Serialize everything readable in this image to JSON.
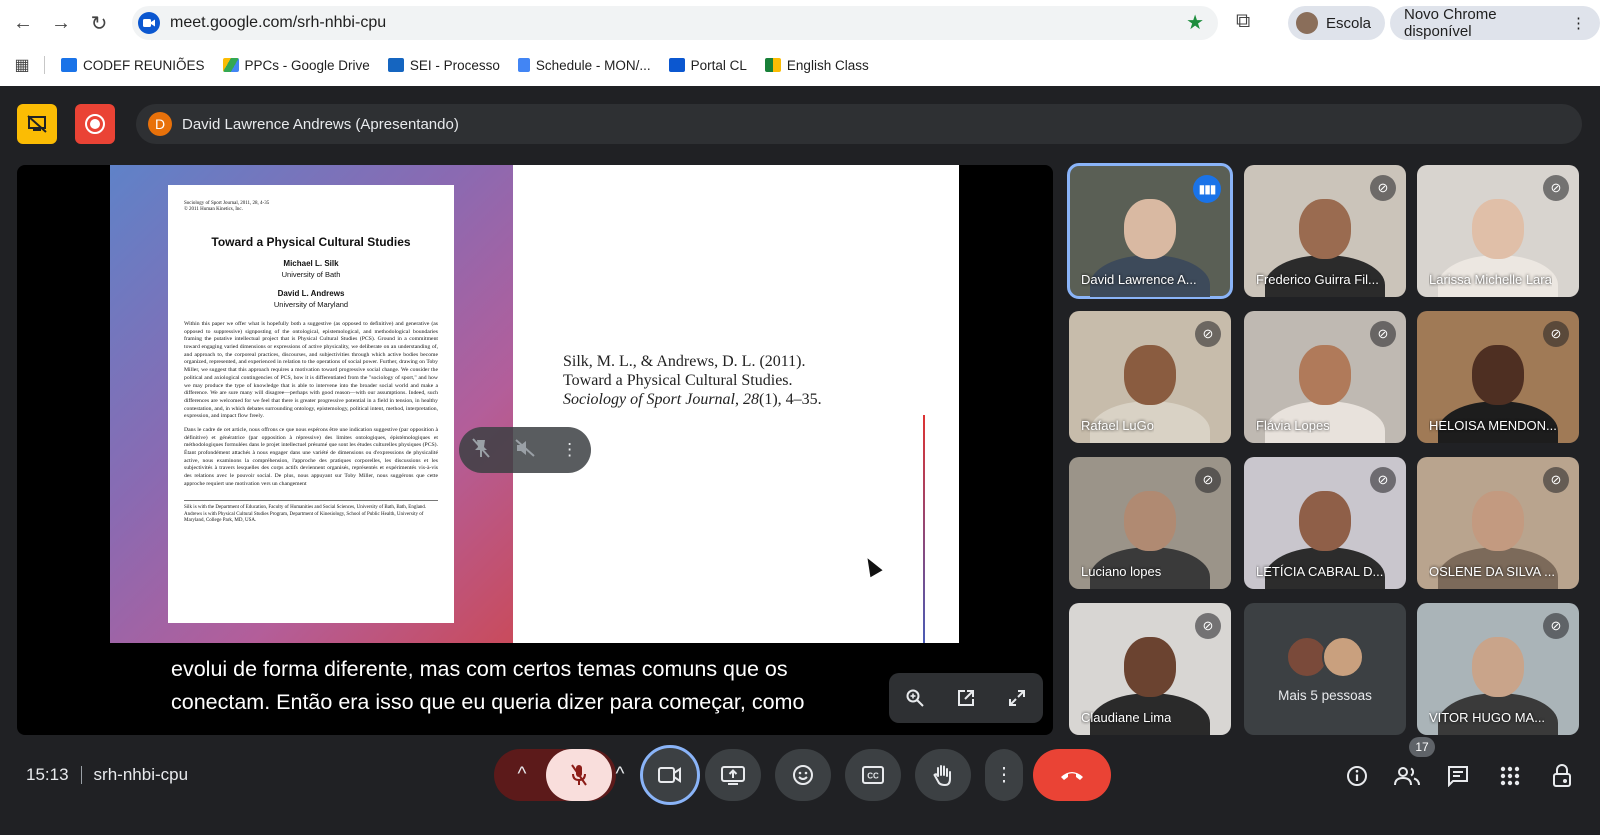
{
  "browser": {
    "url": "meet.google.com/srh-nhbi-cpu",
    "profile_label": "Escola",
    "new_chrome_label": "Novo Chrome disponível",
    "bookmarks": [
      {
        "label": "CODEF REUNIÕES",
        "color": "#1a73e8"
      },
      {
        "label": "PPCs - Google Drive",
        "color": "#34a853"
      },
      {
        "label": "SEI - Processo",
        "color": "#1565c0"
      },
      {
        "label": "Schedule - MON/...",
        "color": "#4285f4"
      },
      {
        "label": "Portal CL",
        "color": "#0b57d0"
      },
      {
        "label": "English Class",
        "color": "#188038"
      }
    ]
  },
  "meet": {
    "presenter_initial": "D",
    "presenter_label": "David Lawrence Andrews (Apresentando)",
    "slide": {
      "paper_meta": "Sociology of Sport Journal, 2011, 28, 4-35\n© 2011 Human Kinetics, Inc.",
      "paper_title": "Toward a Physical Cultural Studies",
      "author1": "Michael L. Silk",
      "affil1": "University of Bath",
      "author2": "David L. Andrews",
      "affil2": "University of Maryland",
      "abstract_en": "Within this paper we offer what is hopefully both a suggestive (as opposed to definitive) and generative (as opposed to suppressive) signposting of the ontological, epistemological, and methodological boundaries framing the putative intellectual project that is Physical Cultural Studies (PCS). Ground in a commitment toward engaging varied dimensions or expressions of active physicality, we deliberate on an understanding of, and approach to, the corporeal practices, discourses, and subjectivities through which active bodies become organized, represented, and experienced in relation to the operations of social power. Further, drawing on Toby Miller, we suggest that this approach requires a motivation toward progressive social change. We consider the political and axiological contingencies of PCS, how it is differentiated from the \"sociology of sport,\" and how we may produce the type of knowledge that is able to intervene into the broader social world and make a difference. We are sure many will disagree—perhaps with good reason—with our assumptions. Indeed, such differences are welcomed for we feel that there is greater progressive potential in a field in tension, in healthy contestation, and, in which debates surrounding ontology, epistemology, political intent, method, interpretation, expression, and impact flow freely.",
      "abstract_fr": "Dans le cadre de cet article, nous offrons ce que nous espérons être une indication suggestive (par opposition à définitive) et génératrice (par opposition à répressive) des limites ontologiques, épistémologiques et méthodologiques formulées dans le projet intellectuel présumé que sont les études culturelles physiques (PCS). Étant profondément attachés à nous engager dans une variété de dimensions ou d'expressions de physicalité active, nous examinons la compréhension, l'approche des pratiques corporelles, les discussions et les subjectivités à travers lesquelles des corps actifs deviennent organisés, représentés et expérimentés vis-à-vis des relations avec le pouvoir social. De plus, nous appuyant sur Toby Miller, nous suggérons que cette approche requiert une motivation vers un changement",
      "footnote": "Silk is with the Department of Education, Faculty of Humanities and Social Sciences, University of Bath, Bath, England. Andrews is with Physical Cultural Studies Program, Department of Kinesiology, School of Public Health, University of Maryland, College Park, MD, USA.",
      "citation_line1": "Silk, M. L., & Andrews, D. L. (2011).",
      "citation_line2": "Toward a Physical Cultural Studies.",
      "citation_journal": "Sociology of Sport Journal",
      "citation_sep": ", ",
      "citation_volume": "28",
      "citation_rest": "(1), 4–35."
    },
    "caption_line1": "evolui de forma diferente, mas com certos temas comuns que os",
    "caption_line2": "conectam. Então era isso que eu queria dizer para começar, como",
    "participants": [
      {
        "name": "David Lawrence A...",
        "speaking": true,
        "bg": "#5a5f55",
        "skin": "#d9b9a2",
        "shirt": "#3d4a5a"
      },
      {
        "name": "Frederico Guirra Fil...",
        "speaking": false,
        "bg": "#cbc4ba",
        "skin": "#9a6b50",
        "shirt": "#2b2b2b"
      },
      {
        "name": "Larissa Michelle Lara",
        "speaking": false,
        "bg": "#d8d4cf",
        "skin": "#e0bfa8",
        "shirt": "#ece7e1"
      },
      {
        "name": "Rafael LuGo",
        "speaking": false,
        "bg": "#c7bcab",
        "skin": "#8a5c40",
        "shirt": "#d9d2c5"
      },
      {
        "name": "Flávia Lopes",
        "speaking": false,
        "bg": "#bfb9b2",
        "skin": "#b07a5a",
        "shirt": "#e8e2dc"
      },
      {
        "name": "HELOISA MENDON...",
        "speaking": false,
        "bg": "#a07a56",
        "skin": "#4e2f22",
        "shirt": "#1d1d1d"
      },
      {
        "name": "Luciano lopes",
        "speaking": false,
        "bg": "#9b9489",
        "skin": "#b08a72",
        "shirt": "#3a3a3a"
      },
      {
        "name": "LETÍCIA CABRAL D...",
        "speaking": false,
        "bg": "#c9c6cd",
        "skin": "#8f5f48",
        "shirt": "#2c2c2c"
      },
      {
        "name": "OSLENE DA SILVA ...",
        "speaking": false,
        "bg": "#b9a48e",
        "skin": "#c39a80",
        "shirt": "#7c6a5a"
      },
      {
        "name": "Claudiane Lima",
        "speaking": false,
        "bg": "#d8d6d3",
        "skin": "#6b4330",
        "shirt": "#2a2a2a"
      },
      {
        "name": "Mais 5 pessoas",
        "speaking": false,
        "more": true
      },
      {
        "name": "VITOR HUGO MA...",
        "speaking": false,
        "bg": "#aab4b8",
        "skin": "#c9a48a",
        "shirt": "#3a3a3a"
      }
    ],
    "time": "15:13",
    "meeting_code": "srh-nhbi-cpu",
    "people_count": "17",
    "colors": {
      "accent": "#8ab4f8",
      "end_call": "#ea4335",
      "mic_off_bg": "#f9dedc",
      "presenting_yellow": "#fbbc04",
      "recording_red": "#ea4335"
    }
  }
}
